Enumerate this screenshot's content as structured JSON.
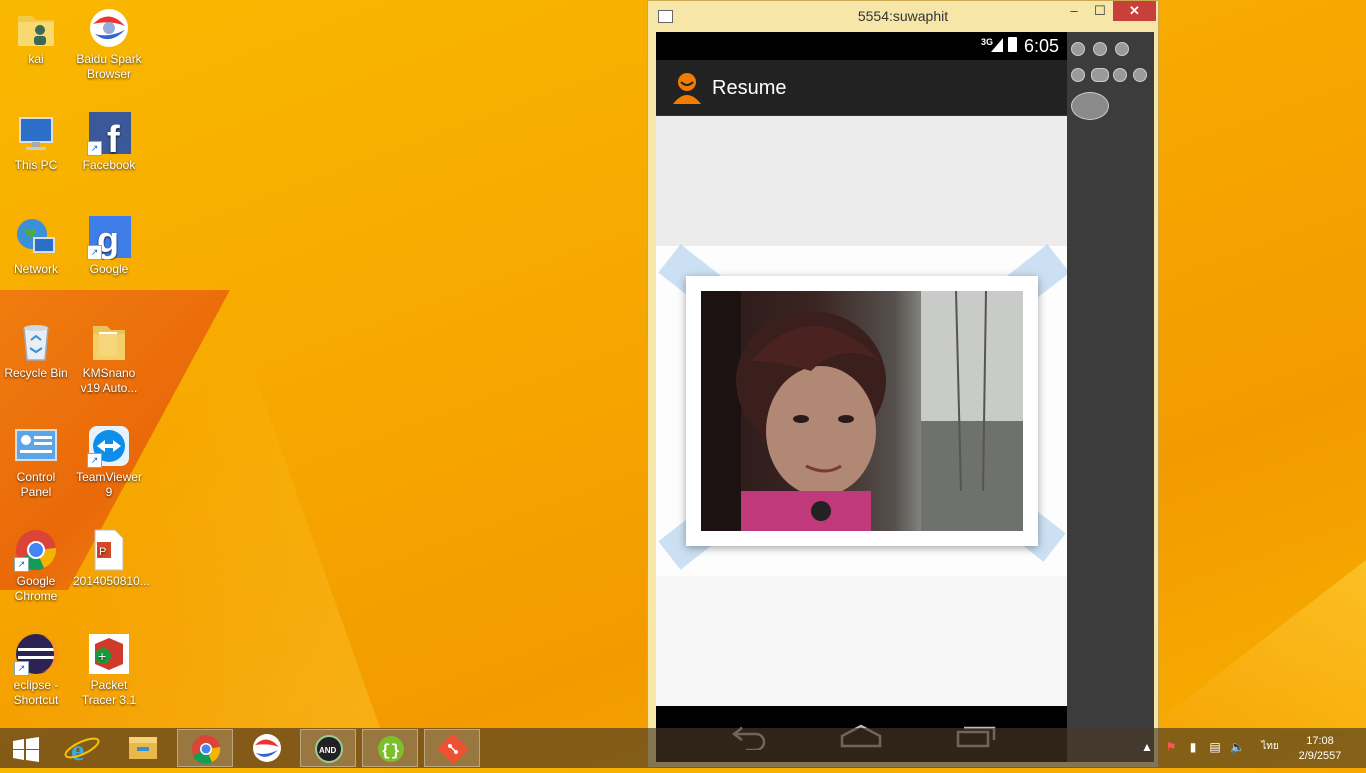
{
  "desktop": {
    "icons": [
      {
        "label": "kai"
      },
      {
        "label": "Baidu Spark Browser"
      },
      {
        "label": "This PC"
      },
      {
        "label": "Facebook"
      },
      {
        "label": "Network"
      },
      {
        "label": "Google"
      },
      {
        "label": "Recycle Bin"
      },
      {
        "label": "KMSnano v19 Auto..."
      },
      {
        "label": "Control Panel"
      },
      {
        "label": "TeamViewer 9"
      },
      {
        "label": "Google Chrome"
      },
      {
        "label": "2014050810..."
      },
      {
        "label": "eclipse - Shortcut"
      },
      {
        "label": "Packet Tracer 3.1"
      }
    ]
  },
  "emulator": {
    "title": "5554:suwaphit",
    "min_label": "–",
    "max_label": "☐",
    "close_label": "✕",
    "status": {
      "network": "3G",
      "time": "6:05"
    },
    "app": {
      "title": "Resume"
    }
  },
  "taskbar": {
    "clock_time": "17:08",
    "clock_date": "2/9/2557",
    "language": "ไทย"
  },
  "colors": {
    "wallpaper": "#f7a800",
    "close": "#c7403a",
    "accent_orange": "#f07d00"
  }
}
